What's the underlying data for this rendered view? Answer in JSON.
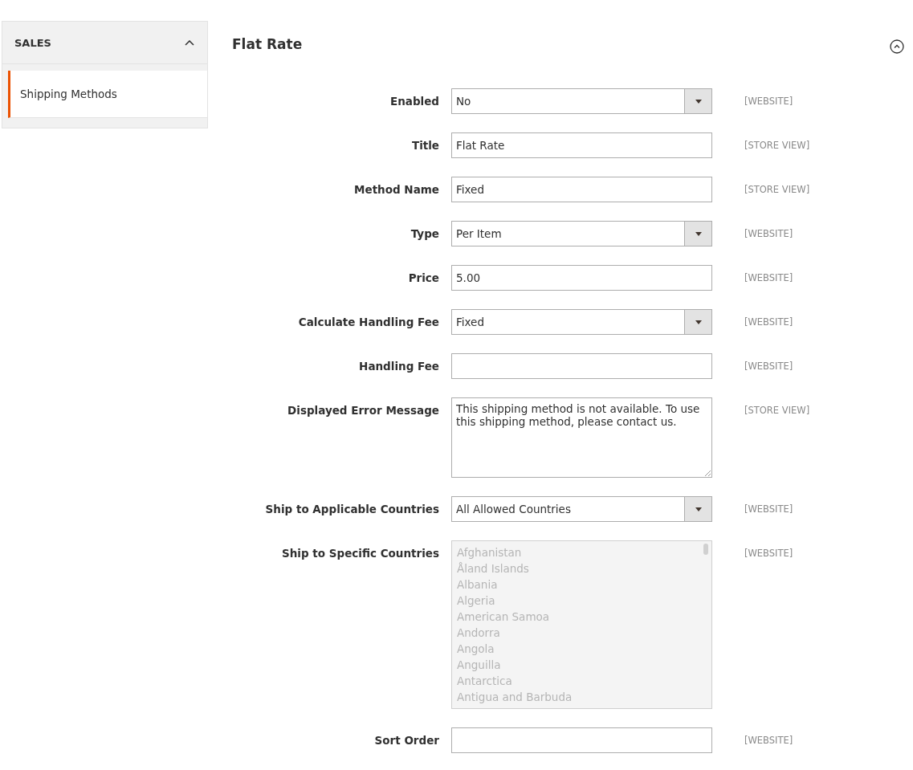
{
  "sidebar": {
    "section": {
      "title": "SALES",
      "expanded": true
    },
    "items": [
      {
        "label": "Shipping Methods",
        "selected": true
      }
    ]
  },
  "section": {
    "title": "Flat Rate",
    "expanded": true
  },
  "fields": [
    {
      "kind": "select",
      "label": "Enabled",
      "value": "No",
      "scope": "[WEBSITE]",
      "disabled": false
    },
    {
      "kind": "text",
      "label": "Title",
      "value": "Flat Rate",
      "scope": "[STORE VIEW]",
      "disabled": false
    },
    {
      "kind": "text",
      "label": "Method Name",
      "value": "Fixed",
      "scope": "[STORE VIEW]",
      "disabled": false
    },
    {
      "kind": "select",
      "label": "Type",
      "value": "Per Item",
      "scope": "[WEBSITE]",
      "disabled": false
    },
    {
      "kind": "text",
      "label": "Price",
      "value": "5.00",
      "scope": "[WEBSITE]",
      "disabled": false
    },
    {
      "kind": "select",
      "label": "Calculate Handling Fee",
      "value": "Fixed",
      "scope": "[WEBSITE]",
      "disabled": false
    },
    {
      "kind": "text",
      "label": "Handling Fee",
      "scope": "[WEBSITE]",
      "disabled": false
    },
    {
      "kind": "textarea",
      "label": "Displayed Error Message",
      "value": "This shipping method is not available. To use this shipping method, please contact us.",
      "scope": "[STORE VIEW]",
      "disabled": false
    },
    {
      "kind": "select",
      "label": "Ship to Applicable Countries",
      "value": "All Allowed Countries",
      "scope": "[WEBSITE]",
      "disabled": false
    },
    {
      "kind": "multiselect",
      "label": "Ship to Specific Countries",
      "options": [
        "Afghanistan",
        "Åland Islands",
        "Albania",
        "Algeria",
        "American Samoa",
        "Andorra",
        "Angola",
        "Anguilla",
        "Antarctica",
        "Antigua and Barbuda"
      ],
      "scope": "[WEBSITE]",
      "disabled": true
    },
    {
      "kind": "text",
      "label": "Sort Order",
      "scope": "[WEBSITE]",
      "disabled": false
    }
  ]
}
